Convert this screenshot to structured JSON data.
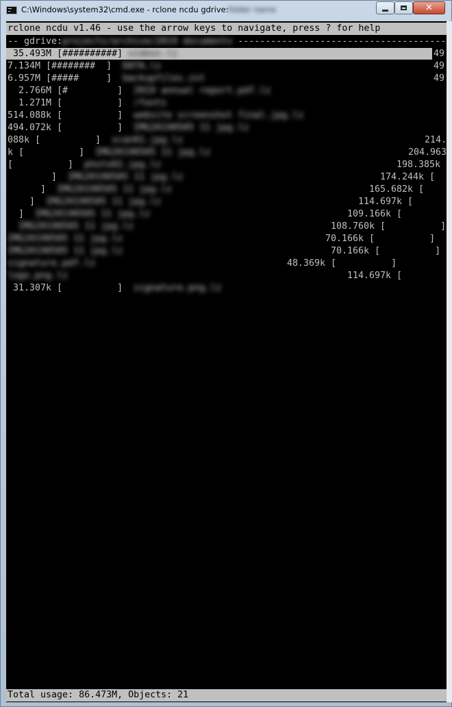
{
  "window": {
    "title": "C:\\Windows\\system32\\cmd.exe - rclone  ncdu gdrive:",
    "title_redacted": "folder name",
    "close_glyph": "✕"
  },
  "console": {
    "header": "rclone ncdu v1.46 - use the arrow keys to navigate, press ? for help",
    "path_prefix": "-- gdrive:",
    "path_redacted": "projects/archive/2019 documents",
    "path_dashes": " -----------------------------------------",
    "rows": [
      {
        "pre": " 35.493M [##########] ",
        "name": "videos.lz",
        "post": "49",
        "selected": true
      },
      {
        "pre": "7.134M [########  ]  ",
        "name": "DATA.lz",
        "post": "49"
      },
      {
        "pre": "6.957M [#####     ]  ",
        "name": "backupfiles.zst",
        "post": "49"
      },
      {
        "pre": "  2.766M [#         ]  ",
        "name": "2019 annual report.pdf.lz",
        "post": ""
      },
      {
        "pre": "  1.271M [          ]  ",
        "name": "/fonts",
        "post": ""
      },
      {
        "pre": "514.088k [          ]  ",
        "name": "website screenshot final.jpg.lz",
        "post": ""
      },
      {
        "pre": "494.072k [          ]  ",
        "name": "IMG20190505 11 jpg.lz",
        "post": ""
      },
      {
        "pre": "088k [          ]  ",
        "name": "scan01.jpg.lz",
        "post": "214."
      },
      {
        "pre": "k [          ]  ",
        "name": "IMG20190505 11 jpg.lz",
        "post": "204.963"
      },
      {
        "pre": "[          ]  ",
        "name": "photo02.jpg.lz",
        "post": "198.385k"
      },
      {
        "pre": "       ]  ",
        "name": "IMG20190505 11 jpg.lz",
        "post": "174.244k ["
      },
      {
        "pre": "      ]  ",
        "name": "IMG20190505 11 jpg.lz",
        "post": "165.682k ["
      },
      {
        "pre": "    ]  ",
        "name": "IMG20190505 11 jpg.lz",
        "post": "114.697k ["
      },
      {
        "pre": "  ]  ",
        "name": "IMG20190505 11 jpg.lz",
        "post": "109.166k ["
      },
      {
        "pre": "  ",
        "name": "IMG20190505 11 jpg.lz",
        "post": "108.760k [          ]"
      },
      {
        "pre": "",
        "name": "IMG20190505 11 jpg.lz",
        "post": "70.166k [          ]"
      },
      {
        "pre": "",
        "name": "IMG20190505 11 jpg.lz",
        "post": "70.166k [          ]"
      },
      {
        "pre": "",
        "name": "signature.pdf.lz",
        "post": "48.369k [          ]  "
      },
      {
        "pre": "",
        "name": "logo.png.lz",
        "post": "114.697k ["
      },
      {
        "pre": " 31.307k [          ]  ",
        "name": "signature.png.lz",
        "post": ""
      }
    ],
    "footer": "Total usage: 86.473M, Objects: 21"
  }
}
